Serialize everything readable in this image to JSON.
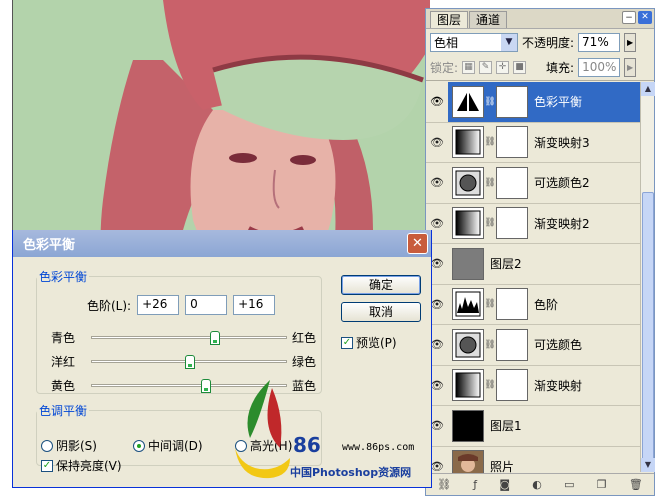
{
  "layers_panel": {
    "tabs": [
      "图层",
      "通道"
    ],
    "blend_mode": "色相",
    "opacity_label": "不透明度:",
    "opacity_value": "71%",
    "lock_label": "锁定:",
    "fill_label": "填充:",
    "fill_value": "100%",
    "layers": [
      {
        "name": "色彩平衡",
        "selected": true,
        "thumb": "balance-icon",
        "mask": true
      },
      {
        "name": "渐变映射3",
        "selected": false,
        "thumb": "gradient-icon",
        "mask": true
      },
      {
        "name": "可选颜色2",
        "selected": false,
        "thumb": "selective-color-icon",
        "mask": true
      },
      {
        "name": "渐变映射2",
        "selected": false,
        "thumb": "gradient-icon",
        "mask": true
      },
      {
        "name": "图层2",
        "selected": false,
        "thumb": "gray-fill",
        "mask": false
      },
      {
        "name": "色阶",
        "selected": false,
        "thumb": "levels-icon",
        "mask": true
      },
      {
        "name": "可选颜色",
        "selected": false,
        "thumb": "selective-color-icon",
        "mask": true
      },
      {
        "name": "渐变映射",
        "selected": false,
        "thumb": "gradient-icon",
        "mask": true
      },
      {
        "name": "图层1",
        "selected": false,
        "thumb": "black-fill",
        "mask": false
      },
      {
        "name": "照片",
        "selected": false,
        "thumb": "photo-thumb",
        "mask": false
      }
    ]
  },
  "dialog": {
    "title": "色彩平衡",
    "group_color_balance": "色彩平衡",
    "levels_label": "色阶(L):",
    "levels": [
      "+26",
      "0",
      "+16"
    ],
    "sliders": [
      {
        "left": "青色",
        "right": "红色",
        "value": 26
      },
      {
        "left": "洋红",
        "right": "绿色",
        "value": 0
      },
      {
        "left": "黄色",
        "right": "蓝色",
        "value": 16
      }
    ],
    "group_tone_balance": "色调平衡",
    "shadows": "阴影(S)",
    "midtones": "中间调(D)",
    "highlights": "高光(H)",
    "preserve_luminosity": "保持亮度(V)",
    "ok": "确定",
    "cancel": "取消",
    "preview": "预览(P)"
  },
  "watermark": {
    "number": "86",
    "url": "www.86ps.com",
    "caption": "中国Photoshop资源网"
  },
  "colors": {
    "canvas_bg": "#b3d3ab",
    "selected_layer": "#316ac5",
    "legend_text": "#0046d5"
  }
}
